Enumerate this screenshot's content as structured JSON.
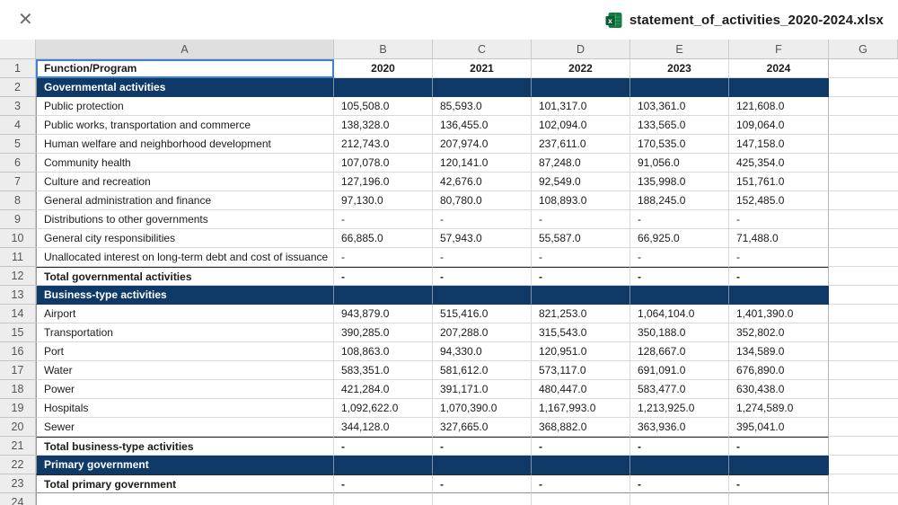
{
  "titlebar": {
    "close_glyph": "✕",
    "filename": "statement_of_activities_2020-2024.xlsx",
    "file_icon": "excel-file-icon",
    "icon_color": "#107C41",
    "icon_dark": "#0b5c32"
  },
  "colors": {
    "section_navy": "#0f3a68",
    "selection_blue": "#3b82d6",
    "header_gray": "#ededed",
    "gridline": "#d9d9d9"
  },
  "spreadsheet": {
    "column_letters": [
      "A",
      "B",
      "C",
      "D",
      "E",
      "F",
      "G"
    ],
    "selected_cell": "A1",
    "rows": [
      {
        "num": 1,
        "type": "header",
        "cells": [
          "Function/Program",
          "2020",
          "2021",
          "2022",
          "2023",
          "2024"
        ]
      },
      {
        "num": 2,
        "type": "section",
        "cells": [
          "Governmental activities",
          "",
          "",
          "",
          "",
          ""
        ]
      },
      {
        "num": 3,
        "type": "data",
        "cells": [
          "Public protection",
          "105,508.0",
          "85,593.0",
          "101,317.0",
          "103,361.0",
          "121,608.0"
        ]
      },
      {
        "num": 4,
        "type": "data",
        "cells": [
          "Public works, transportation and commerce",
          "138,328.0",
          "136,455.0",
          "102,094.0",
          "133,565.0",
          "109,064.0"
        ]
      },
      {
        "num": 5,
        "type": "data",
        "cells": [
          "Human welfare and neighborhood development",
          "212,743.0",
          "207,974.0",
          "237,611.0",
          "170,535.0",
          "147,158.0"
        ]
      },
      {
        "num": 6,
        "type": "data",
        "cells": [
          "Community health",
          "107,078.0",
          "120,141.0",
          "87,248.0",
          "91,056.0",
          "425,354.0"
        ]
      },
      {
        "num": 7,
        "type": "data",
        "cells": [
          "Culture and recreation",
          "127,196.0",
          "42,676.0",
          "92,549.0",
          "135,998.0",
          "151,761.0"
        ]
      },
      {
        "num": 8,
        "type": "data",
        "cells": [
          "General administration and finance",
          "97,130.0",
          "80,780.0",
          "108,893.0",
          "188,245.0",
          "152,485.0"
        ]
      },
      {
        "num": 9,
        "type": "data",
        "cells": [
          "Distributions to other governments",
          "-",
          "-",
          "-",
          "-",
          "-"
        ]
      },
      {
        "num": 10,
        "type": "data",
        "cells": [
          "General city responsibilities",
          "66,885.0",
          "57,943.0",
          "55,587.0",
          "66,925.0",
          "71,488.0"
        ]
      },
      {
        "num": 11,
        "type": "data",
        "cells": [
          "Unallocated interest on long-term debt and cost of issuance",
          "-",
          "-",
          "-",
          "-",
          "-"
        ]
      },
      {
        "num": 12,
        "type": "total",
        "cells": [
          "Total governmental activities",
          "-",
          "-",
          "-",
          "-",
          "-"
        ]
      },
      {
        "num": 13,
        "type": "section",
        "cells": [
          "Business-type activities",
          "",
          "",
          "",
          "",
          ""
        ]
      },
      {
        "num": 14,
        "type": "data",
        "cells": [
          "Airport",
          "943,879.0",
          "515,416.0",
          "821,253.0",
          "1,064,104.0",
          "1,401,390.0"
        ]
      },
      {
        "num": 15,
        "type": "data",
        "cells": [
          "Transportation",
          "390,285.0",
          "207,288.0",
          "315,543.0",
          "350,188.0",
          "352,802.0"
        ]
      },
      {
        "num": 16,
        "type": "data",
        "cells": [
          "Port",
          "108,863.0",
          "94,330.0",
          "120,951.0",
          "128,667.0",
          "134,589.0"
        ]
      },
      {
        "num": 17,
        "type": "data",
        "cells": [
          "Water",
          "583,351.0",
          "581,612.0",
          "573,117.0",
          "691,091.0",
          "676,890.0"
        ]
      },
      {
        "num": 18,
        "type": "data",
        "cells": [
          "Power",
          "421,284.0",
          "391,171.0",
          "480,447.0",
          "583,477.0",
          "630,438.0"
        ]
      },
      {
        "num": 19,
        "type": "data",
        "cells": [
          "Hospitals",
          "1,092,622.0",
          "1,070,390.0",
          "1,167,993.0",
          "1,213,925.0",
          "1,274,589.0"
        ]
      },
      {
        "num": 20,
        "type": "data",
        "cells": [
          "Sewer",
          "344,128.0",
          "327,665.0",
          "368,882.0",
          "363,936.0",
          "395,041.0"
        ]
      },
      {
        "num": 21,
        "type": "total",
        "cells": [
          "Total business-type activities",
          "-",
          "-",
          "-",
          "-",
          "-"
        ]
      },
      {
        "num": 22,
        "type": "section",
        "cells": [
          "Primary government",
          "",
          "",
          "",
          "",
          ""
        ]
      },
      {
        "num": 23,
        "type": "total",
        "cells": [
          "Total primary government",
          "-",
          "-",
          "-",
          "-",
          "-"
        ]
      },
      {
        "num": 24,
        "type": "empty",
        "cells": [
          "",
          "",
          "",
          "",
          "",
          ""
        ]
      }
    ]
  }
}
